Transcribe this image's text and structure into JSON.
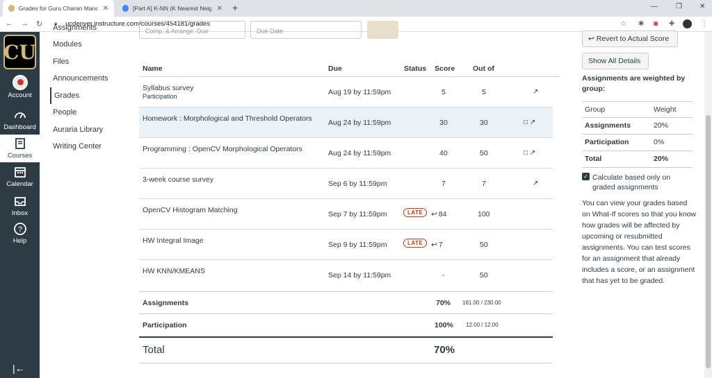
{
  "browser": {
    "tabs": [
      {
        "title": "Grades for Guru Charan Manchi...",
        "active": true
      },
      {
        "title": "[Part A] K-NN (K Nearest Neigh...",
        "active": false
      }
    ],
    "url": "ucdenver.instructure.com/courses/454181/grades"
  },
  "global_nav": {
    "logo": "CU",
    "items": [
      {
        "label": "Account"
      },
      {
        "label": "Dashboard"
      },
      {
        "label": "Courses"
      },
      {
        "label": "Calendar"
      },
      {
        "label": "Inbox"
      },
      {
        "label": "Help"
      }
    ]
  },
  "course_nav": {
    "items": [
      {
        "label": "Assignments"
      },
      {
        "label": "Modules"
      },
      {
        "label": "Files"
      },
      {
        "label": "Announcements"
      },
      {
        "label": "Grades"
      },
      {
        "label": "People"
      },
      {
        "label": "Auraria Library"
      },
      {
        "label": "Writing Center"
      }
    ]
  },
  "filters": {
    "left": "Comp. & Arrange. Due",
    "right": "Due Date"
  },
  "grades_table": {
    "headers": {
      "name": "Name",
      "due": "Due",
      "status": "Status",
      "score": "Score",
      "out_of": "Out of"
    },
    "rows": [
      {
        "name": "Syllabus survey",
        "sub": "Participation",
        "due": "Aug 19 by 11:59pm",
        "status": "",
        "score": "5",
        "out_of": "5",
        "icons": "↗"
      },
      {
        "name": "Homework : Morphological and Threshold Operators",
        "sub": "",
        "due": "Aug 24 by 11:59pm",
        "status": "",
        "score": "30",
        "out_of": "30",
        "icons": "□ ↗"
      },
      {
        "name": "Programming : OpenCV Morphological Operators",
        "sub": "",
        "due": "Aug 24 by 11:59pm",
        "status": "",
        "score": "40",
        "out_of": "50",
        "icons": "□ ↗"
      },
      {
        "name": "3-week course survey",
        "sub": "",
        "due": "Sep 6 by 11:59pm",
        "status": "",
        "score": "7",
        "out_of": "7",
        "icons": "↗"
      },
      {
        "name": "OpenCV Histogram Matching",
        "sub": "",
        "due": "Sep 7 by 11:59pm",
        "status": "LATE",
        "score": "84",
        "out_of": "100",
        "icons": ""
      },
      {
        "name": "HW Integral Image",
        "sub": "",
        "due": "Sep 9 by 11:59pm",
        "status": "LATE",
        "score": "7",
        "out_of": "50",
        "icons": ""
      },
      {
        "name": "HW KNN/KMEANS",
        "sub": "",
        "due": "Sep 14 by 11:59pm",
        "status": "",
        "score": "-",
        "out_of": "50",
        "icons": ""
      }
    ],
    "totals": [
      {
        "name": "Assignments",
        "percent": "70%",
        "fraction": "161.00 / 230.00"
      },
      {
        "name": "Participation",
        "percent": "100%",
        "fraction": "12.00 / 12.00"
      }
    ],
    "grand_total": {
      "name": "Total",
      "percent": "70%"
    }
  },
  "sidebar": {
    "revert_label": "Revert to Actual Score",
    "show_details_label": "Show All Details",
    "weight_title": "Assignments are weighted by group:",
    "weight_headers": {
      "group": "Group",
      "weight": "Weight"
    },
    "weights": [
      {
        "group": "Assignments",
        "weight": "20%"
      },
      {
        "group": "Participation",
        "weight": "0%"
      },
      {
        "group": "Total",
        "weight": "20%"
      }
    ],
    "calc_label": "Calculate based only on graded assignments",
    "calc_checked": true,
    "info_text": "You can view your grades based on What-If scores so that you know how grades will be affected by upcoming or resubmitted assignments. You can test scores for an assignment that already includes a score, or an assignment that has yet to be graded."
  },
  "colors": {
    "nav_bg": "#2d3b45",
    "late": "#c23c0d",
    "highlight_row": "#eaf2f8",
    "brand_gold": "#cfb87c"
  }
}
